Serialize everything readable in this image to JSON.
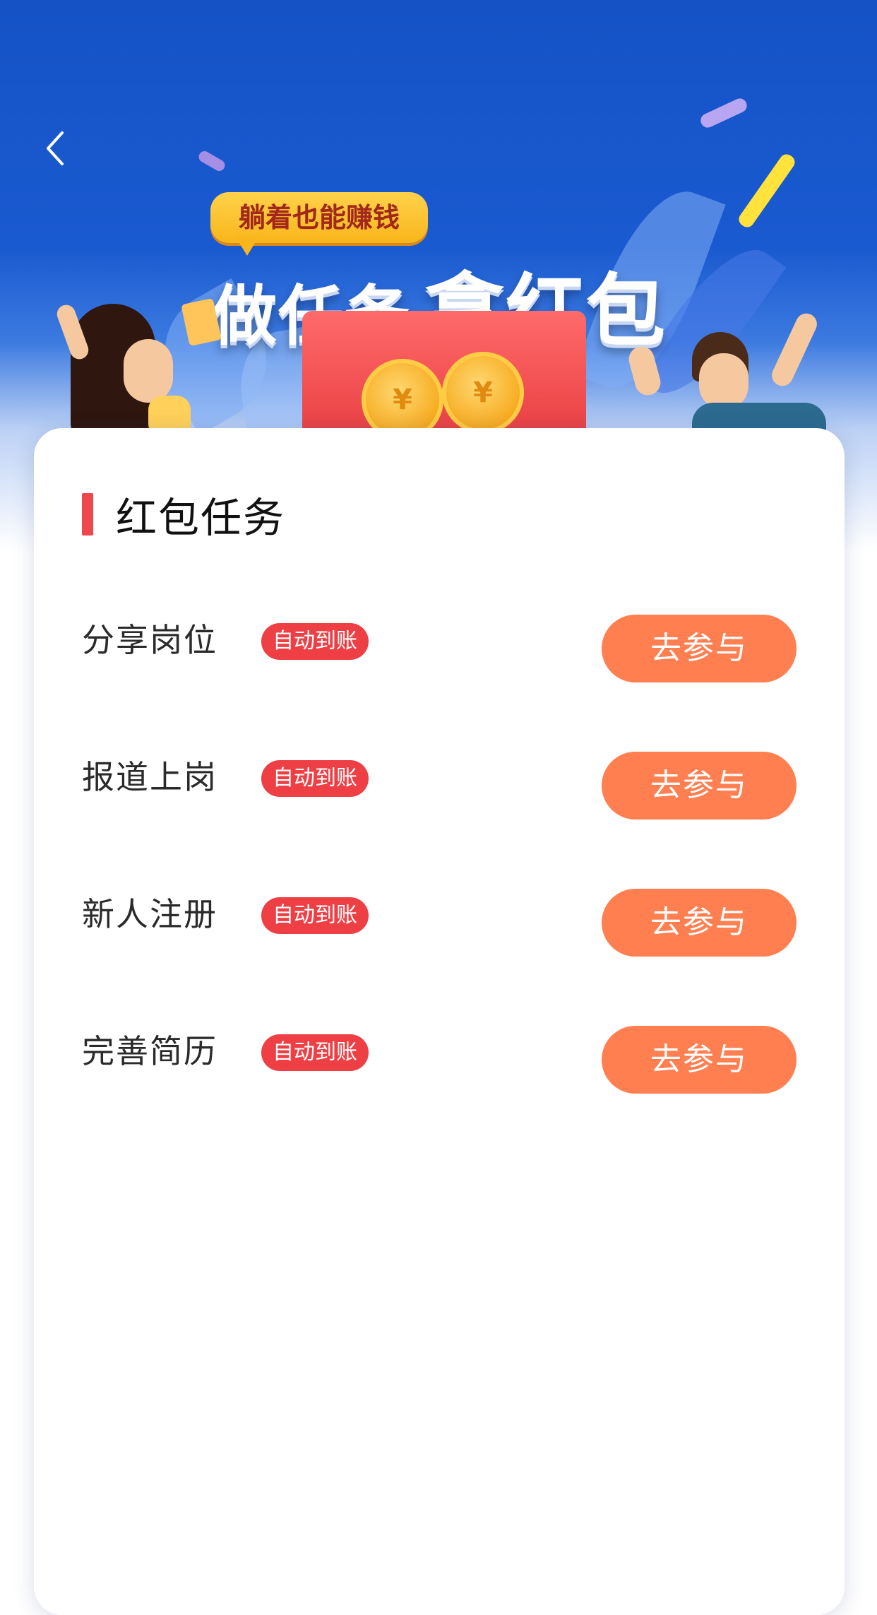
{
  "banner": {
    "bubble_text": "躺着也能赚钱",
    "headline_small": "做任务",
    "headline_big": "拿红包",
    "coin_symbol": "¥"
  },
  "section": {
    "title": "红包任务"
  },
  "tasks": [
    {
      "name": "分享岗位",
      "badge": "自动到账",
      "button": "去参与"
    },
    {
      "name": "报道上岗",
      "badge": "自动到账",
      "button": "去参与"
    },
    {
      "name": "新人注册",
      "badge": "自动到账",
      "button": "去参与"
    },
    {
      "name": "完善简历",
      "badge": "自动到账",
      "button": "去参与"
    }
  ],
  "icons": {
    "back": "chevron-left-icon"
  },
  "colors": {
    "banner_blue": "#1452c6",
    "accent_red": "#f0474c",
    "badge_red": "#ee3f45",
    "button_orange": "#ff7f51"
  }
}
